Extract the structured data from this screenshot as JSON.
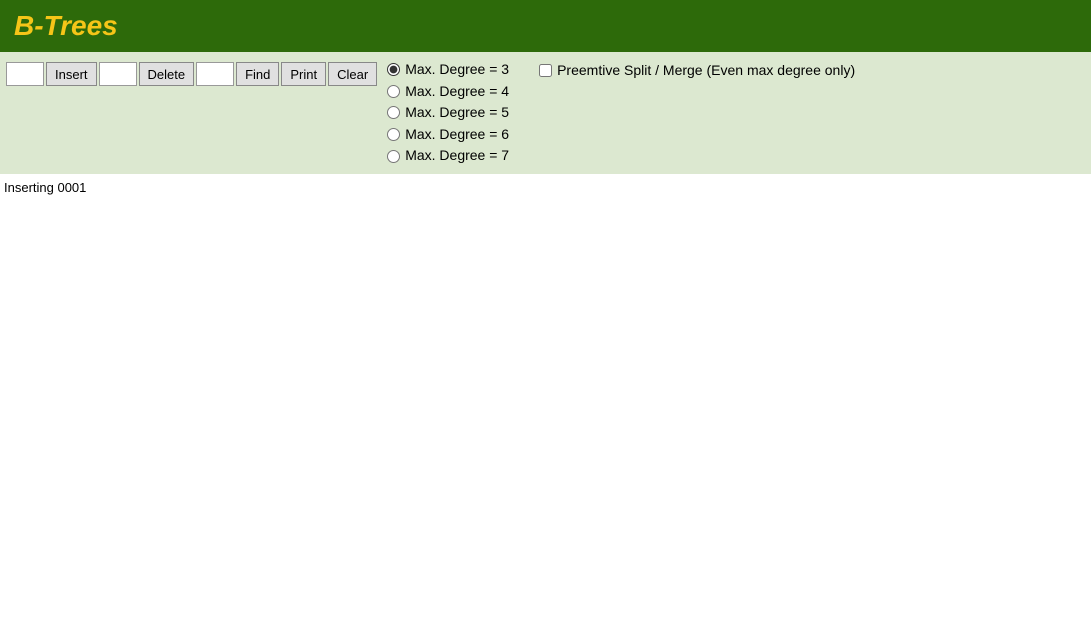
{
  "header": {
    "title": "B-Trees"
  },
  "toolbar": {
    "input1_value": "",
    "input1_placeholder": "",
    "insert_label": "Insert",
    "input2_value": "",
    "input2_placeholder": "",
    "delete_label": "Delete",
    "input3_value": "",
    "input3_placeholder": "",
    "find_label": "Find",
    "print_label": "Print",
    "clear_label": "Clear",
    "degrees": [
      {
        "label": "Max. Degree = 3",
        "checked": true
      },
      {
        "label": "Max. Degree = 4",
        "checked": false
      },
      {
        "label": "Max. Degree = 5",
        "checked": false
      },
      {
        "label": "Max. Degree = 6",
        "checked": false
      },
      {
        "label": "Max. Degree = 7",
        "checked": false
      }
    ],
    "preemtive_label": "Preemtive Split / Merge (Even max degree only)",
    "preemtive_checked": false
  },
  "status": {
    "message": "Inserting 0001"
  }
}
